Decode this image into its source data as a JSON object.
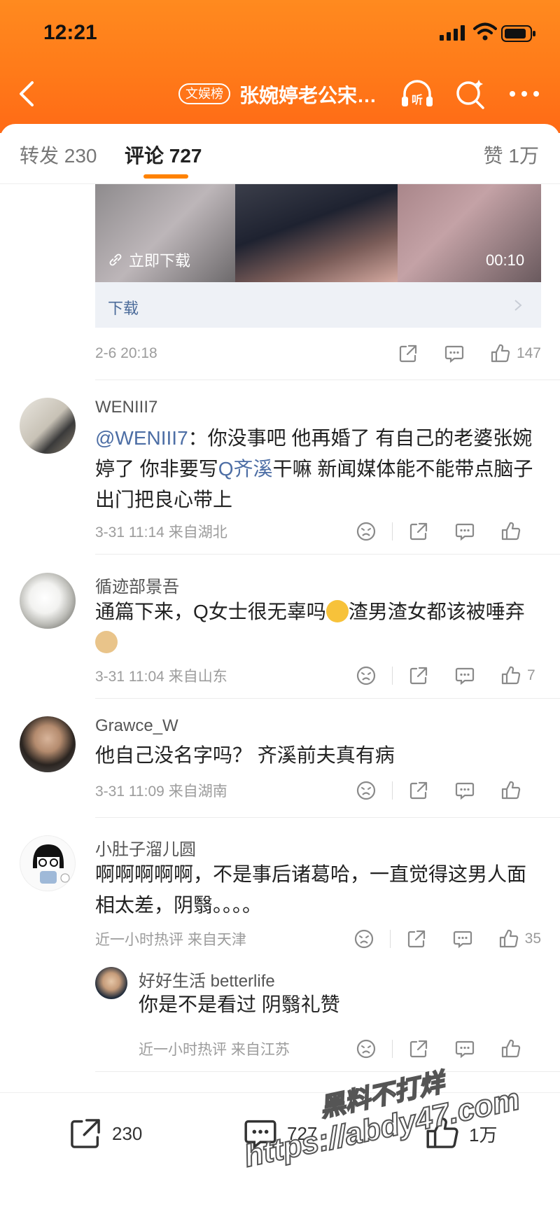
{
  "status": {
    "time": "12:21"
  },
  "nav": {
    "badge": "文娱榜",
    "title": "张婉婷老公宋…"
  },
  "tabs": {
    "repost": "转发 230",
    "comment": "评论 727",
    "like": "赞 1万"
  },
  "colors": {
    "accent": "#ff8200",
    "link": "#4d6ea5"
  },
  "post": {
    "download_tag": "立即下载",
    "duration": "00:10",
    "download_label": "下载",
    "date": "2-6 20:18",
    "likes": "147"
  },
  "comments": [
    {
      "user": "WENIII7",
      "mention": "@WENIII7",
      "text_a": "：你没事吧 他再婚了 有自己的老婆张婉婷了 你非要写",
      "link": "Q齐溪",
      "text_b": "干嘛 新闻媒体能不能带点脑子 出门把良心带上",
      "meta": "3-31 11:14  来自湖北",
      "likes": ""
    },
    {
      "user": "循迹部景吾",
      "text": "通篇下来，Q女士很无辜吗",
      "text_after": "渣男渣女都该被唾弃",
      "meta": "3-31 11:04  来自山东",
      "likes": "7"
    },
    {
      "user": "Grawce_W",
      "text": "他自己没名字吗？  齐溪前夫真有病",
      "meta": "3-31 11:09  来自湖南",
      "likes": ""
    },
    {
      "user": "小肚子溜儿圆",
      "text": "啊啊啊啊啊，不是事后诸葛哈，一直觉得这男人面相太差，阴翳。。。。",
      "meta": "近一小时热评  来自天津",
      "likes": "35"
    }
  ],
  "reply": {
    "user": "好好生活 betterlife",
    "text": "你是不是看过 阴翳礼赞",
    "meta": "近一小时热评  来自江苏",
    "likes": ""
  },
  "bottom": {
    "repost": "230",
    "comment": "727",
    "like": "1万"
  },
  "watermark": {
    "line1": "黑料不打烊",
    "line2": "https://abdy47.com"
  }
}
